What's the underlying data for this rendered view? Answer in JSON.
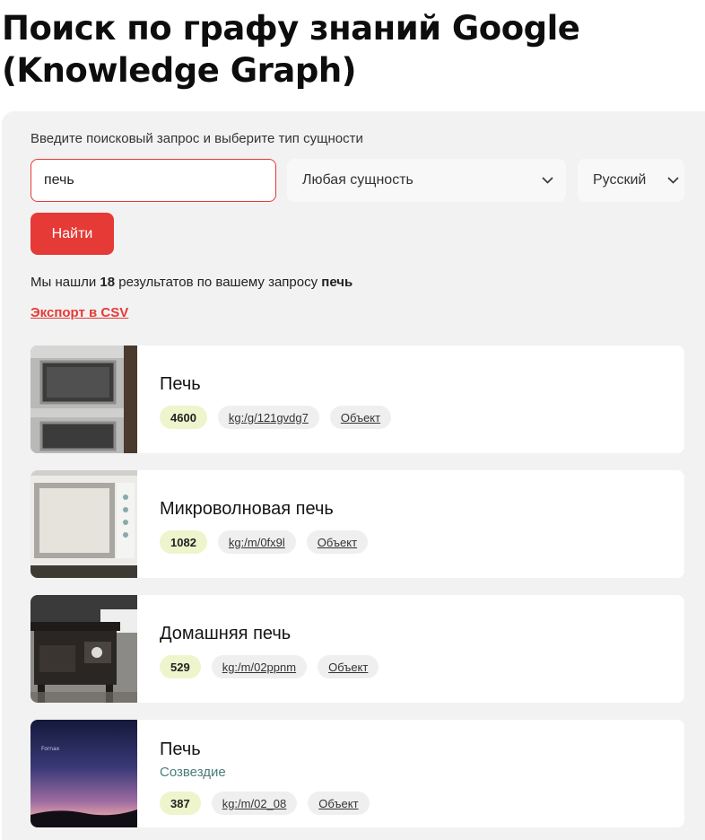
{
  "page": {
    "title": "Поиск по графу знаний Google (Knowledge Graph)"
  },
  "search": {
    "label": "Введите поисковый запрос и выберите тип сущности",
    "query": "печь",
    "entity_type": "Любая сущность",
    "language": "Русский",
    "submit_label": "Найти"
  },
  "summary": {
    "prefix": "Мы нашли ",
    "count": "18",
    "middle": " результатов по вашему запросу ",
    "query": "печь"
  },
  "export_label": "Экспорт в CSV",
  "results": [
    {
      "title": "Печь",
      "subtitle": "",
      "score": "4600",
      "id": "kg:/g/121gvdg7",
      "type": "Объект",
      "image": "oven-icon"
    },
    {
      "title": "Микроволновая печь",
      "subtitle": "",
      "score": "1082",
      "id": "kg:/m/0fx9l",
      "type": "Объект",
      "image": "microwave-icon"
    },
    {
      "title": "Домашняя печь",
      "subtitle": "",
      "score": "529",
      "id": "kg:/m/02ppnm",
      "type": "Объект",
      "image": "stove-icon"
    },
    {
      "title": "Печь",
      "subtitle": "Созвездие",
      "score": "387",
      "id": "kg:/m/02_08",
      "type": "Объект",
      "image": "night-sky-icon",
      "image_caption": "Fornax"
    }
  ],
  "colors": {
    "accent": "#e53a35",
    "panel": "#f2f2f2",
    "score_tag": "#eef5cc",
    "subtitle": "#4a7d7a"
  }
}
